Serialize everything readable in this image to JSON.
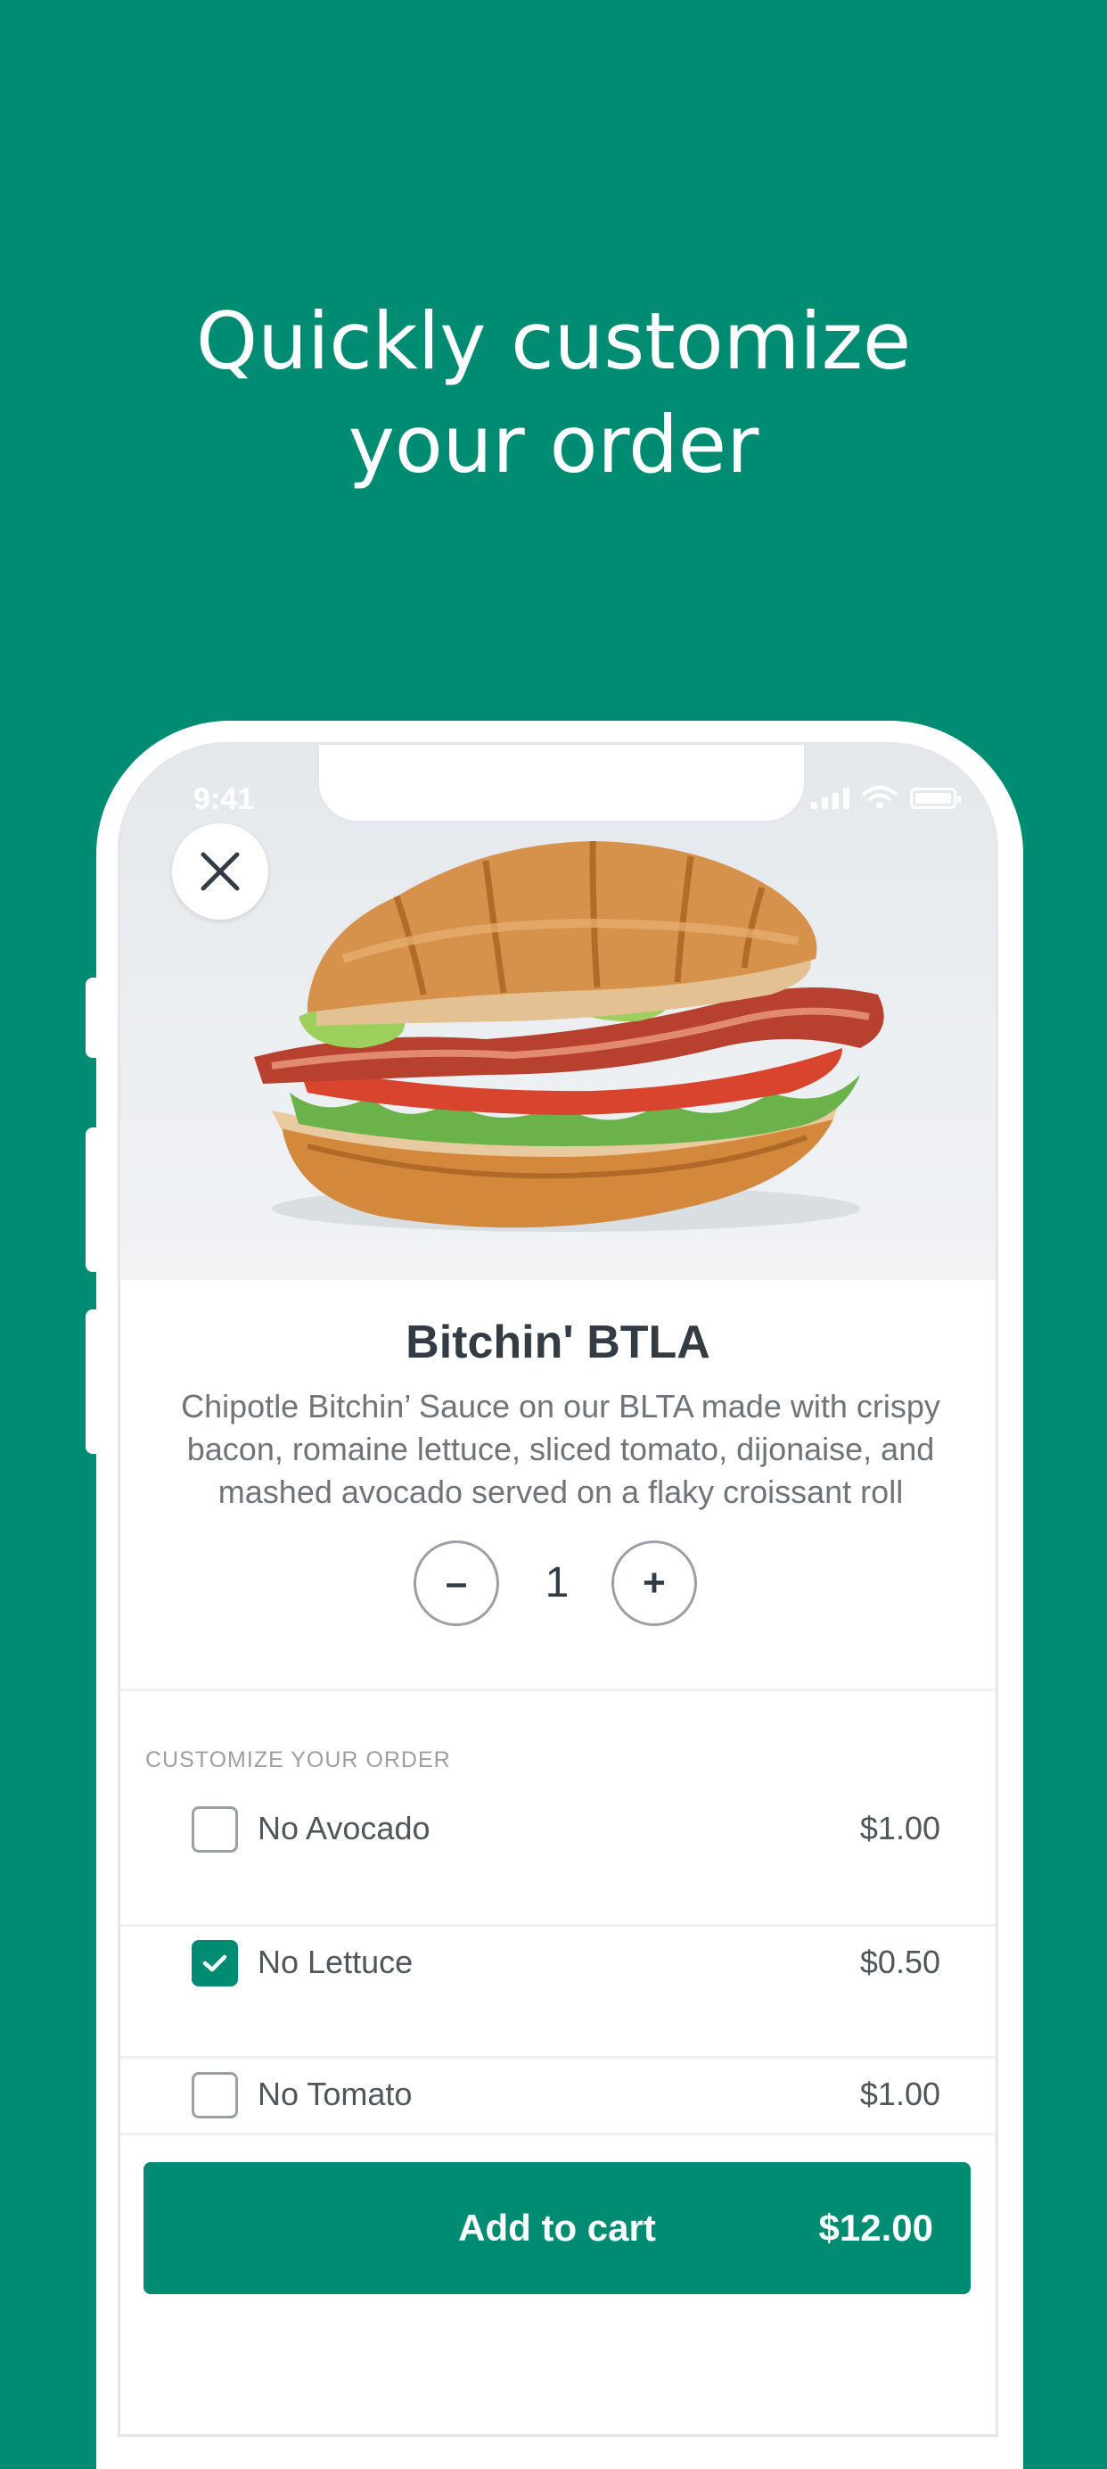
{
  "headline": {
    "line1": "Quickly customize",
    "line2": "your order"
  },
  "status_bar": {
    "time": "9:41"
  },
  "product": {
    "name": "Bitchin' BTLA",
    "description_lines": [
      "Chipotle Bitchin’ Sauce on our BLTA made with crispy",
      "bacon, romaine lettuce, sliced tomato, dijonaise, and",
      "mashed avocado served on a flaky croissant roll"
    ],
    "quantity": "1",
    "minus_label": "–",
    "plus_label": "+"
  },
  "customize": {
    "section_label": "CUSTOMIZE YOUR ORDER",
    "options": [
      {
        "label": "No Avocado",
        "price": "$1.00",
        "checked": false
      },
      {
        "label": "No Lettuce",
        "price": "$0.50",
        "checked": true
      },
      {
        "label": "No Tomato",
        "price": "$1.00",
        "checked": false
      }
    ]
  },
  "cart": {
    "label": "Add to cart",
    "price": "$12.00"
  },
  "colors": {
    "brand": "#008c72",
    "title": "#333b44",
    "muted": "#6e7479"
  },
  "icons": {
    "close": "close-icon",
    "check": "checkmark-icon",
    "signal": "cellular-signal-icon",
    "wifi": "wifi-icon",
    "battery": "battery-icon"
  }
}
